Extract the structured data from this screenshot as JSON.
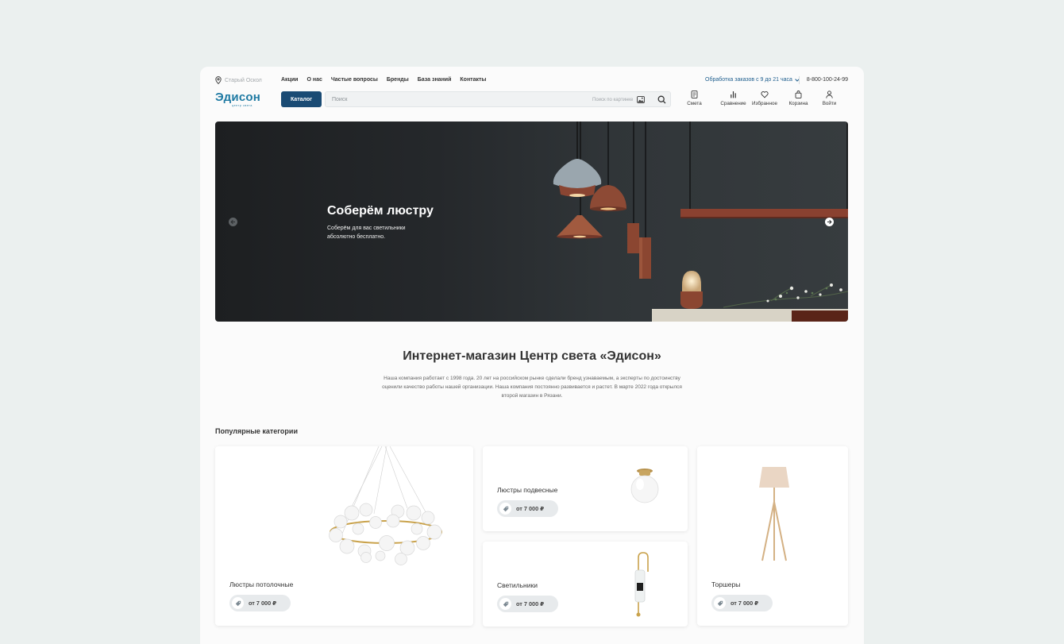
{
  "topbar": {
    "city": "Старый Оскол",
    "nav": [
      "Акции",
      "О нас",
      "Частые вопросы",
      "Бренды",
      "База знаний",
      "Контакты"
    ],
    "work_time": "Обработка заказов с 9 до 21 часа",
    "phone": "8-800-100-24-99"
  },
  "header": {
    "logo_title": "Эдисон",
    "logo_subtitle": "центр света",
    "catalog_label": "Каталог",
    "search_placeholder": "Поиск",
    "image_search_label": "Поиск по картинке",
    "actions": [
      {
        "label": "Смета",
        "icon": "estimate-icon"
      },
      {
        "label": "Сравнение",
        "icon": "compare-icon"
      },
      {
        "label": "Избранное",
        "icon": "heart-icon"
      },
      {
        "label": "Корзина",
        "icon": "cart-icon"
      },
      {
        "label": "Войти",
        "icon": "user-icon"
      }
    ]
  },
  "hero": {
    "title": "Соберём люстру",
    "subtitle": "Соберём для вас светильники абсолютно бесплатно."
  },
  "about": {
    "title": "Интернет-магазин Центр света «Эдисон»",
    "text": "Наша компания работает с 1998 года. 20 лет на российском рынке сделали бренд узнаваемым, а эксперты по достоинству оценили качество работы нашей организации. Наша компания постоянно развивается и растет. В марте 2022 года открылся второй магазин в Рязани."
  },
  "categories": {
    "title": "Популярные категории",
    "items": [
      {
        "name": "Люстры потолочные",
        "price": "от 7 000 ₽"
      },
      {
        "name": "Люстры подвесные",
        "price": "от 7 000 ₽"
      },
      {
        "name": "Светильники",
        "price": "от 7 000 ₽"
      },
      {
        "name": "Торшеры",
        "price": "от 7 000 ₽"
      }
    ]
  },
  "colors": {
    "brand": "#1f7aa3",
    "catalog_button": "#1a4b74",
    "link": "#1d5d8d",
    "copper": "#8c4a35"
  }
}
